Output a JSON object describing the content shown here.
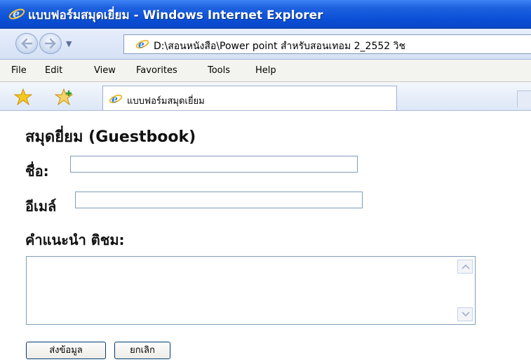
{
  "window": {
    "title": "แบบฟอร์มสมุดเยี่ยม - Windows Internet Explorer"
  },
  "address_bar": {
    "url": "D:\\สอนหนังสือ\\Power point สำหรับสอนเทอม 2_2552 วิช"
  },
  "menu": {
    "items": [
      "File",
      "Edit",
      "View",
      "Favorites",
      "Tools",
      "Help"
    ]
  },
  "tab": {
    "label": "แบบฟอร์มสมุดเยี่ยม"
  },
  "form": {
    "heading": "สมุดยี่ยม (Guestbook)",
    "name_label": "ชื่อ:",
    "name_value": "",
    "email_label": "อีเมล์",
    "email_value": "",
    "comment_label": "คำแนะนำ ติชม:",
    "comment_value": "",
    "submit_label": "ส่งข้อมูล",
    "cancel_label": "ยกเลิก"
  },
  "icons": {
    "browser": "ie-icon",
    "back": "back-arrow-icon",
    "forward": "forward-arrow-icon",
    "favorites": "favorites-star-icon",
    "add_favorite": "add-favorite-icon"
  },
  "colors": {
    "titlebar": "#0a4fd6",
    "input_border": "#7f9db9",
    "button_border": "#003c74"
  }
}
